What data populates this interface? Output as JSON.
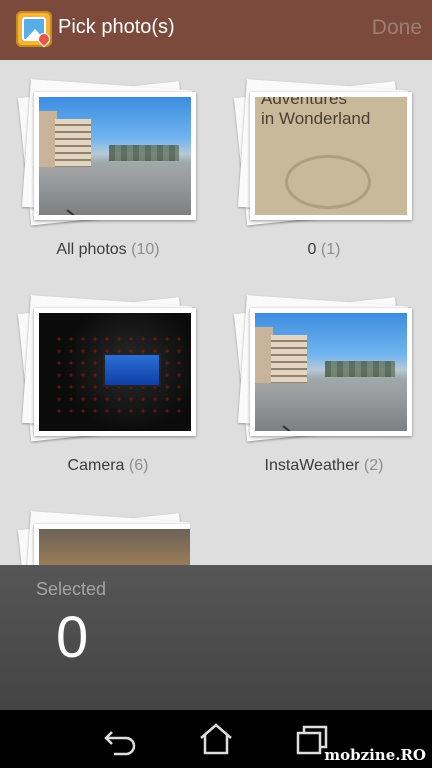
{
  "actionbar": {
    "title": "Pick photo(s)",
    "done_label": "Done"
  },
  "albums": [
    {
      "name": "All photos",
      "count": "(10)",
      "thumb": "street"
    },
    {
      "name": "0",
      "count": "(1)",
      "thumb": "wonderland",
      "thumb_text_1": "Adventures",
      "thumb_text_2": "in Wonderland"
    },
    {
      "name": "Camera",
      "count": "(6)",
      "thumb": "camera"
    },
    {
      "name": "InstaWeather",
      "count": "(2)",
      "thumb": "street"
    },
    {
      "name": "",
      "count": "",
      "thumb": "sunset"
    }
  ],
  "selected": {
    "label": "Selected",
    "count": "0"
  },
  "navbar": {
    "icons": [
      "back-icon",
      "home-icon",
      "recent-apps-icon"
    ]
  },
  "watermark": "mobzine.RO",
  "colors": {
    "actionbar": "#7b4a3c",
    "background": "#dedede",
    "selected_panel": "#4d4d4d"
  }
}
